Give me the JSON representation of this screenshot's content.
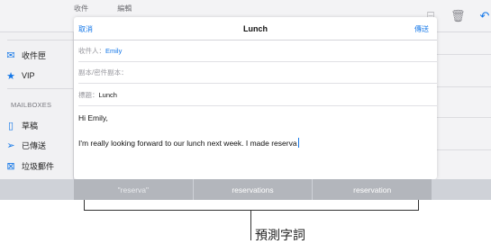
{
  "background_mail": {
    "top_left_texts": [
      "收件",
      "編輯"
    ],
    "top_icons": [
      "folder-icon",
      "folder-icon",
      "trash-icon",
      "reply-icon",
      "compose-icon"
    ],
    "sidebar": {
      "items": [
        {
          "label": "收件匣",
          "icon": "inbox-icon"
        },
        {
          "label": "VIP",
          "icon": "star-icon"
        }
      ],
      "section_header": "MAILBOXES",
      "mailboxes": [
        {
          "label": "草稿",
          "icon": "document-icon"
        },
        {
          "label": "已傳送",
          "icon": "send-icon"
        },
        {
          "label": "垃圾郵件",
          "icon": "junk-icon"
        }
      ]
    }
  },
  "compose": {
    "cancel_label": "取消",
    "title": "Lunch",
    "send_label": "傳送",
    "to_label": "收件人：",
    "to_value": "Emily",
    "cc_label": "副本/密件副本：",
    "subject_label": "標題：",
    "subject_value": "Lunch",
    "body_greeting": "Hi Emily,",
    "body_text": "I'm really looking forward to our lunch next week. I made reserva"
  },
  "predictive": {
    "suggestions": [
      "\"reserva\"",
      "reservations",
      "reservation"
    ]
  },
  "annotation": {
    "callout": "預測字詞"
  },
  "colors": {
    "accent": "#1477e8",
    "predict_bar": "#b3b6bc"
  }
}
